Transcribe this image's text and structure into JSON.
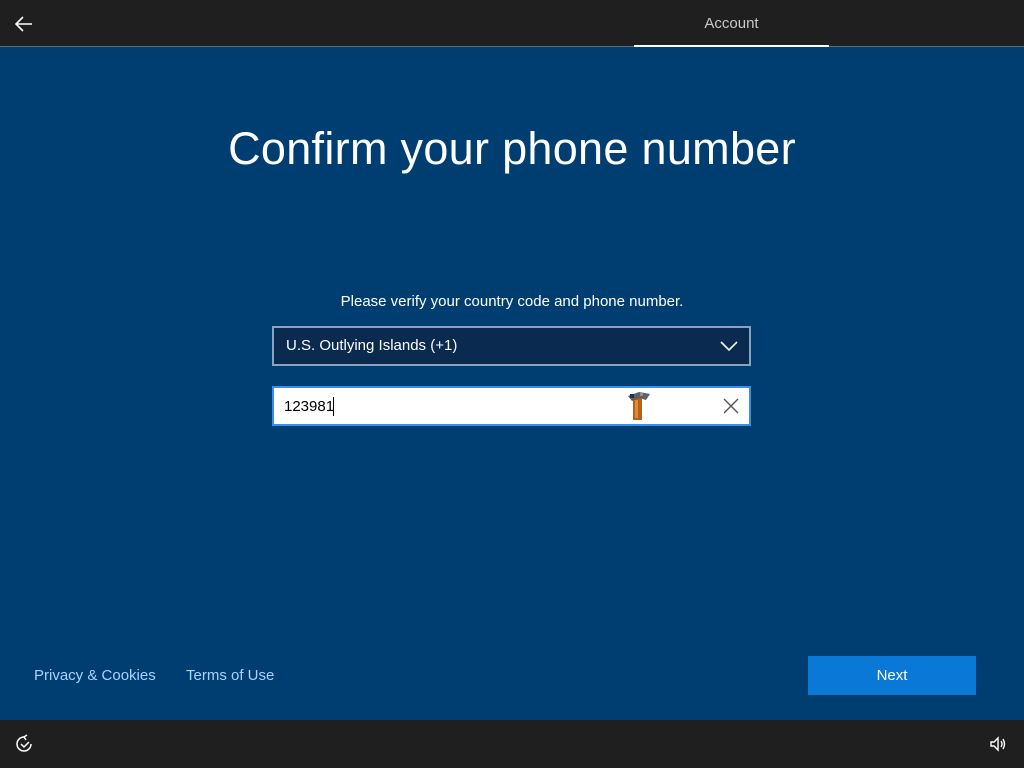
{
  "header": {
    "tab_label": "Account",
    "back_icon": "back-arrow-icon"
  },
  "main": {
    "title": "Confirm your phone number",
    "instruction": "Please verify your country code and phone number.",
    "country_select": {
      "selected": "U.S. Outlying Islands (+1)",
      "icon": "chevron-down-icon"
    },
    "phone_input": {
      "value": "123981",
      "clear_icon": "close-icon"
    }
  },
  "footer_links": {
    "privacy": "Privacy & Cookies",
    "terms": "Terms of Use"
  },
  "actions": {
    "next_label": "Next"
  },
  "bottombar": {
    "left_icon": "ease-of-access-icon",
    "right_icon": "volume-icon"
  },
  "colors": {
    "background": "#003e72",
    "topbar": "#1f1f1f",
    "accent": "#0a78d7",
    "link": "#a9d1ff"
  }
}
